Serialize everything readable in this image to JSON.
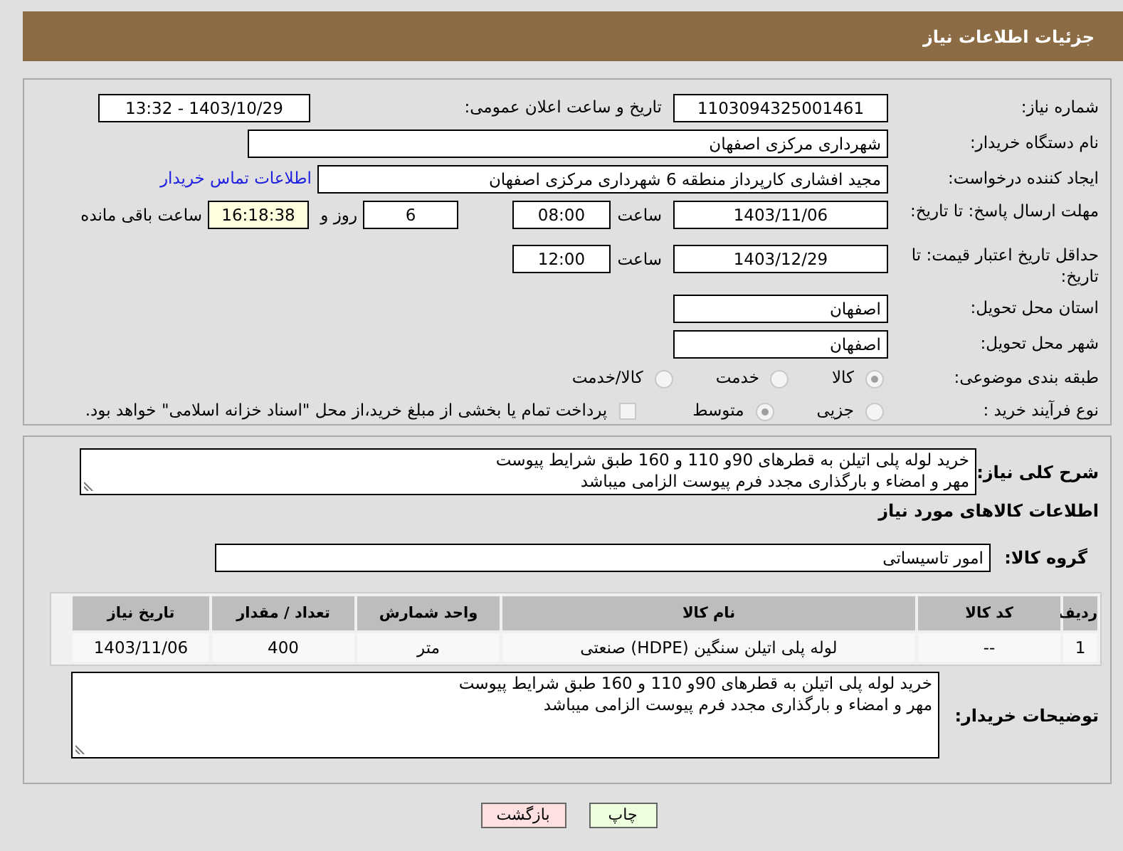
{
  "header": {
    "title": "جزئیات اطلاعات نیاز"
  },
  "need_info": {
    "need_number": {
      "label": "شماره نیاز:",
      "value": "1103094325001461"
    },
    "announce": {
      "label": "تاریخ و ساعت اعلان عمومی:",
      "value": "1403/10/29 - 13:32"
    },
    "buyer_org": {
      "label": "نام دستگاه خریدار:",
      "value": "شهرداری مرکزی اصفهان"
    },
    "creator": {
      "label": "ایجاد کننده درخواست:",
      "value": "مجید افشاری کارپرداز منطقه 6 شهرداری مرکزی اصفهان",
      "link": "اطلاعات تماس خریدار"
    },
    "deadline": {
      "label": "مهلت ارسال پاسخ: تا تاریخ:",
      "date": "1403/11/06",
      "time_label": "ساعت",
      "time": "08:00",
      "days": "6",
      "days_label": "روز و",
      "remaining": "16:18:38",
      "remaining_label": "ساعت باقی مانده"
    },
    "validity": {
      "label": "حداقل تاریخ اعتبار قیمت: تا تاریخ:",
      "date": "1403/12/29",
      "time_label": "ساعت",
      "time": "12:00"
    },
    "province": {
      "label": "استان محل تحویل:",
      "value": "اصفهان"
    },
    "city": {
      "label": "شهر محل تحویل:",
      "value": "اصفهان"
    },
    "category": {
      "label": "طبقه بندی موضوعی:",
      "options": [
        {
          "label": "کالا",
          "selected": true
        },
        {
          "label": "خدمت",
          "selected": false
        },
        {
          "label": "کالا/خدمت",
          "selected": false
        }
      ]
    },
    "process": {
      "label": "نوع فرآیند خرید :",
      "options": [
        {
          "label": "جزیی",
          "selected": false
        },
        {
          "label": "متوسط",
          "selected": true
        }
      ],
      "payment": {
        "label": "پرداخت تمام یا بخشی از مبلغ خرید،از محل \"اسناد خزانه اسلامی\" خواهد بود.",
        "checked": false
      }
    }
  },
  "goods": {
    "description": {
      "label": "شرح کلی نیاز:",
      "lines": [
        "خرید لوله پلی اتیلن به قطرهای 90و 110 و 160 طبق شرایط پیوست",
        "مهر و امضاء و بارگذاری مجدد فرم پیوست الزامی میباشد"
      ]
    },
    "heading": "اطلاعات کالاهای مورد نیاز",
    "group": {
      "label": "گروه کالا:",
      "value": "امور تاسیساتی"
    },
    "table": {
      "columns": [
        "ردیف",
        "کد کالا",
        "نام کالا",
        "واحد شمارش",
        "تعداد / مقدار",
        "تاریخ نیاز"
      ],
      "rows": [
        [
          "1",
          "--",
          "لوله پلی اتیلن سنگین (HDPE) صنعتی",
          "متر",
          "400",
          "1403/11/06"
        ]
      ]
    },
    "buyer_notes": {
      "label": "توضیحات خریدار:",
      "lines": [
        "خرید لوله پلی اتیلن به قطرهای 90و 110 و 160 طبق شرایط پیوست",
        "مهر و امضاء و بارگذاری مجدد فرم پیوست الزامی میباشد"
      ]
    }
  },
  "buttons": [
    {
      "kind": "print",
      "label": "چاپ"
    },
    {
      "kind": "back",
      "label": "بازگشت"
    }
  ]
}
